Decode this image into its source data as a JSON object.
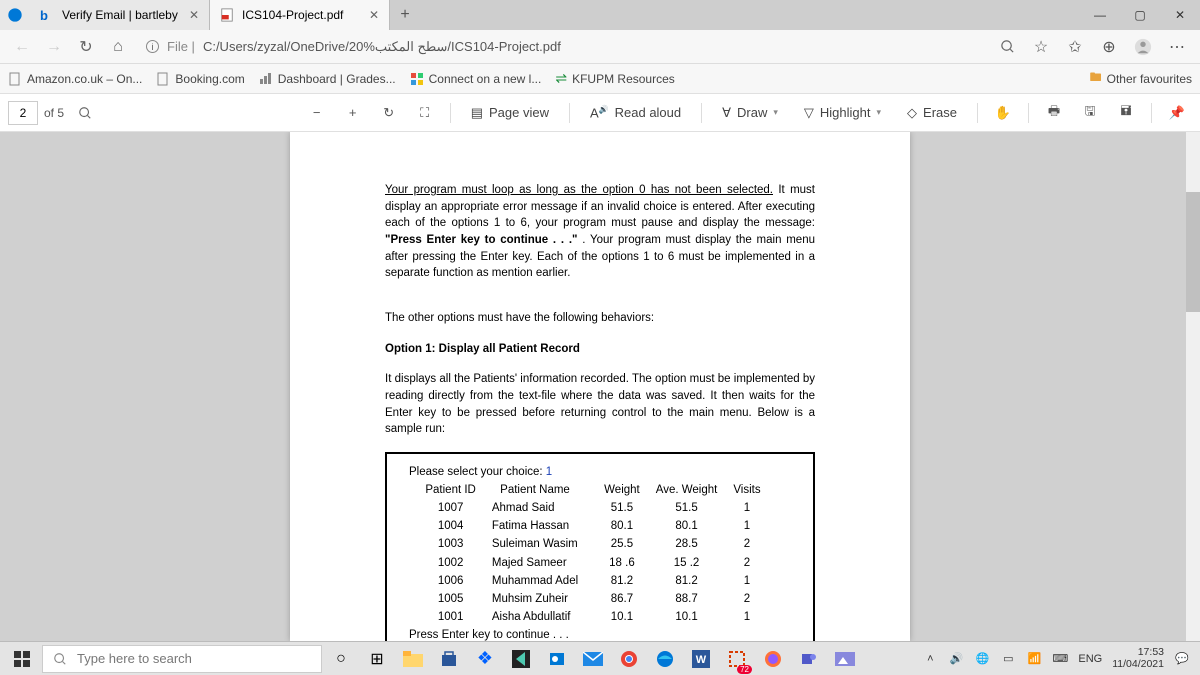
{
  "tabs": [
    {
      "label": "Verify Email | bartleby",
      "icon": "b"
    },
    {
      "label": "ICS104-Project.pdf",
      "icon": "pdf"
    }
  ],
  "url": {
    "prefix": "File |",
    "path": "C:/Users/zyzal/OneDrive/سطح المكتب%20/ICS104-Project.pdf"
  },
  "bookmarks": [
    {
      "label": "Amazon.co.uk – On..."
    },
    {
      "label": "Booking.com"
    },
    {
      "label": "Dashboard | Grades..."
    },
    {
      "label": "Connect on a new l..."
    },
    {
      "label": "KFUPM Resources"
    }
  ],
  "other_fav": "Other favourites",
  "pdf_toolbar": {
    "page_current": "2",
    "page_of": "of 5",
    "page_view": "Page view",
    "read_aloud": "Read aloud",
    "draw": "Draw",
    "highlight": "Highlight",
    "erase": "Erase"
  },
  "doc": {
    "p1a": "Your program must loop as long as the option 0 has not been selected.",
    "p1b": " It must display an appropriate error message if an invalid choice is entered. After executing each of the options 1 to 6, your program must pause and display the message: ",
    "p1c": "\"Press Enter key to continue . . .\"",
    "p1d": " . Your program must display the main menu after pressing the Enter key. Each of the options 1 to 6 must be implemented in a separate function as mention earlier.",
    "p2": "The other options must have the following behaviors:",
    "p3a": "Option 1: ",
    "p3b": "Display all Patient Record",
    "p4": "It displays all the Patients' information recorded. The option must be implemented by reading directly from the text-file where the data was saved. It then waits for the Enter key to be pressed before returning control to the main menu. Below is a sample run:",
    "sample_top": "Please select your choice:  ",
    "sample_choice": "1",
    "headers": [
      "Patient ID",
      "Patient Name",
      "Weight",
      "Ave. Weight",
      "Visits"
    ],
    "rows": [
      [
        "1007",
        "Ahmad   Said",
        "51.5",
        "51.5",
        "1"
      ],
      [
        "1004",
        "Fatima  Hassan",
        "80.1",
        "80.1",
        "1"
      ],
      [
        "1003",
        "Suleiman Wasim",
        "25.5",
        "28.5",
        "2"
      ],
      [
        "1002",
        "Majed  Sameer",
        "18 .6",
        "15 .2",
        "2"
      ],
      [
        "1006",
        "Muhammad  Adel",
        "81.2",
        "81.2",
        "1"
      ],
      [
        "1005",
        "Muhsim Zuheir",
        "86.7",
        "88.7",
        "2"
      ],
      [
        "1001",
        "Aisha  Abdullatif",
        "10.1",
        "10.1",
        "1"
      ]
    ],
    "sample_bottom": "Press Enter key to continue . . ."
  },
  "search_placeholder": "Type here to search",
  "tray": {
    "lang": "ENG",
    "time": "17:53",
    "date": "11/04/2021",
    "badge": "72"
  }
}
